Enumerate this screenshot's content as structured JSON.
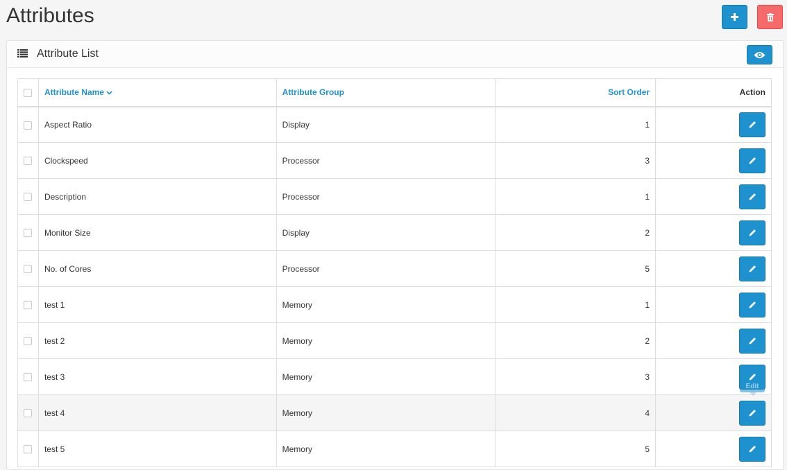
{
  "page": {
    "title": "Attributes"
  },
  "panel": {
    "title": "Attribute List"
  },
  "table": {
    "columns": {
      "name": "Attribute Name",
      "group": "Attribute Group",
      "sort": "Sort Order",
      "action": "Action"
    },
    "rows": [
      {
        "name": "Aspect Ratio",
        "group": "Display",
        "sort": "1"
      },
      {
        "name": "Clockspeed",
        "group": "Processor",
        "sort": "3"
      },
      {
        "name": "Description",
        "group": "Processor",
        "sort": "1"
      },
      {
        "name": "Monitor Size",
        "group": "Display",
        "sort": "2"
      },
      {
        "name": "No. of Cores",
        "group": "Processor",
        "sort": "5"
      },
      {
        "name": "test 1",
        "group": "Memory",
        "sort": "1"
      },
      {
        "name": "test 2",
        "group": "Memory",
        "sort": "2"
      },
      {
        "name": "test 3",
        "group": "Memory",
        "sort": "3"
      },
      {
        "name": "test 4",
        "group": "Memory",
        "sort": "4"
      },
      {
        "name": "test 5",
        "group": "Memory",
        "sort": "5"
      }
    ]
  },
  "tooltip": {
    "text": "Edit"
  },
  "icons": {
    "add": "plus-icon",
    "delete": "trash-icon",
    "list": "list-icon",
    "filter": "eye-icon",
    "sort": "chevron-down-icon",
    "edit": "pencil-icon"
  },
  "colors": {
    "primary": "#1e91cf",
    "danger": "#f56b6b",
    "hover_row": "#f5f5f5"
  }
}
